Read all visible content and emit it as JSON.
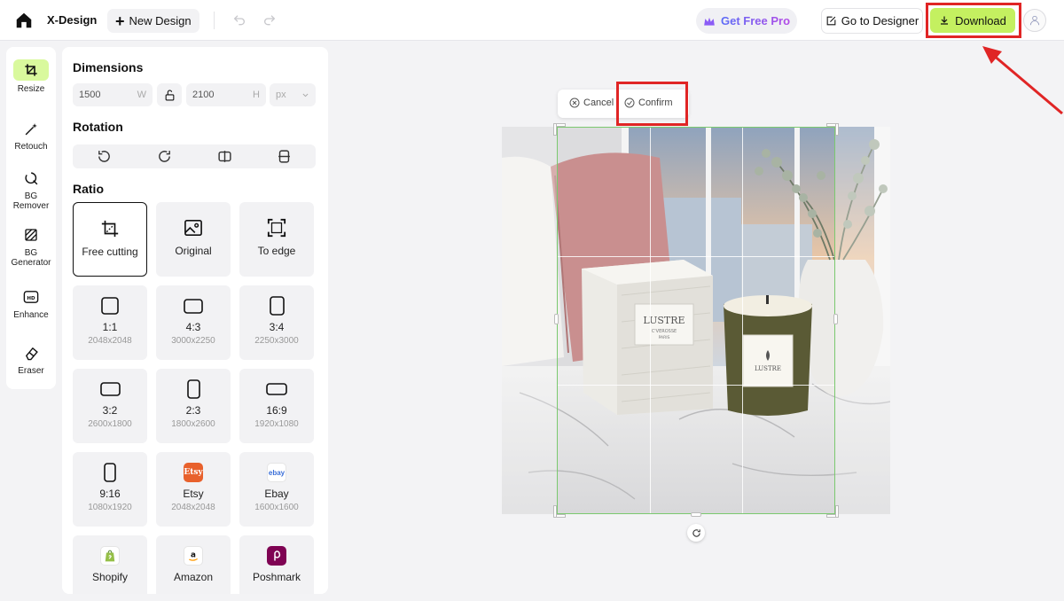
{
  "topbar": {
    "brand": "X-Design",
    "new_design_label": "New Design",
    "get_pro_label": "Get Free Pro",
    "go_designer_label": "Go to Designer",
    "download_label": "Download"
  },
  "rail": {
    "items": [
      {
        "label": "Resize",
        "icon": "crop-resize-icon",
        "active": true
      },
      {
        "label": "Retouch",
        "icon": "magic-wand-icon"
      },
      {
        "label": "BG Remover",
        "icon": "bg-remover-icon"
      },
      {
        "label": "BG Generator",
        "icon": "bg-generator-icon"
      },
      {
        "label": "Enhance",
        "icon": "hd-icon"
      },
      {
        "label": "Eraser",
        "icon": "eraser-icon"
      }
    ]
  },
  "panel": {
    "dimensions_title": "Dimensions",
    "width_value": "1500",
    "width_unit": "W",
    "height_value": "2100",
    "height_unit": "H",
    "unit_value": "px",
    "rotation_title": "Rotation",
    "ratio_title": "Ratio",
    "ratios": [
      {
        "label": "Free cutting",
        "size": "",
        "icon": "free-cutting-icon"
      },
      {
        "label": "Original",
        "size": "",
        "icon": "image-icon"
      },
      {
        "label": "To edge",
        "size": "",
        "icon": "to-edge-icon"
      },
      {
        "label": "1:1",
        "size": "2048x2048"
      },
      {
        "label": "4:3",
        "size": "3000x2250"
      },
      {
        "label": "3:4",
        "size": "2250x3000"
      },
      {
        "label": "3:2",
        "size": "2600x1800"
      },
      {
        "label": "2:3",
        "size": "1800x2600"
      },
      {
        "label": "16:9",
        "size": "1920x1080"
      },
      {
        "label": "9:16",
        "size": "1080x1920"
      },
      {
        "label": "Etsy",
        "size": "2048x2048",
        "logo_text": "Etsy"
      },
      {
        "label": "Ebay",
        "size": "1600x1600",
        "logo_text": "ebay"
      },
      {
        "label": "Shopify",
        "size": ""
      },
      {
        "label": "Amazon",
        "size": ""
      },
      {
        "label": "Poshmark",
        "size": ""
      }
    ]
  },
  "canvas": {
    "cancel_label": "Cancel",
    "confirm_label": "Confirm",
    "product_brand": "LUSTRE",
    "product_sub": "C'VEROSSE",
    "product_city": "PARIS",
    "candle_brand": "LUSTRE"
  },
  "colors": {
    "accent": "#c4f060",
    "highlight": "#e02525",
    "crop_border": "#7bc96f"
  }
}
